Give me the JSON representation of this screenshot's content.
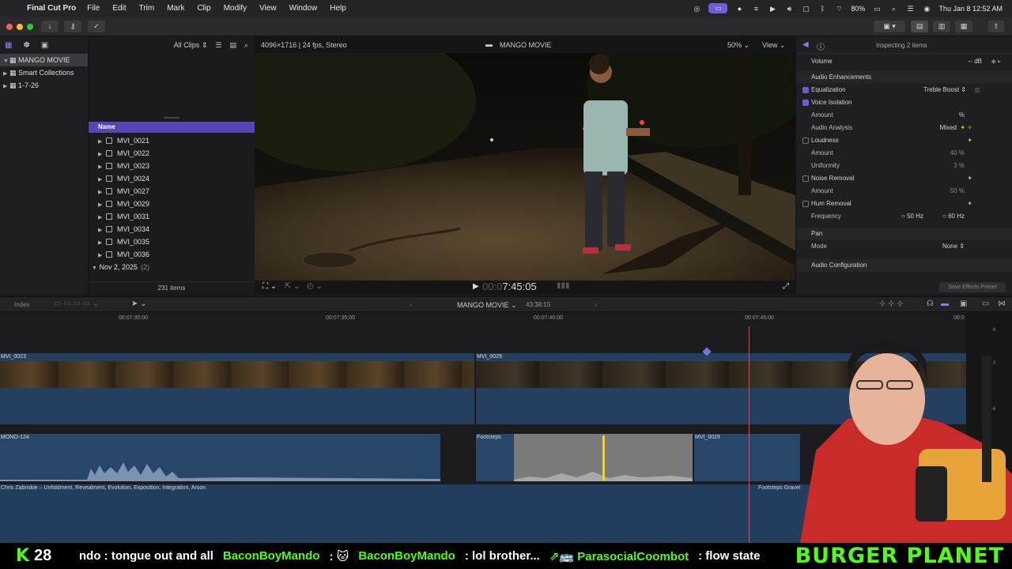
{
  "menubar": {
    "app_name": "Final Cut Pro",
    "items": [
      "File",
      "Edit",
      "Trim",
      "Mark",
      "Clip",
      "Modify",
      "View",
      "Window",
      "Help"
    ],
    "battery": "80%",
    "datetime": "Thu Jan 8  12:52 AM"
  },
  "library": {
    "root": "MANGO MOVIE",
    "items": [
      "Smart Collections",
      "1-7-26"
    ]
  },
  "browser": {
    "filter": "All Clips",
    "column_name": "Name",
    "clips": [
      "MVI_0021",
      "MVI_0022",
      "MVI_0023",
      "MVI_0024",
      "MVI_0027",
      "MVI_0029",
      "MVI_0031",
      "MVI_0034",
      "MVI_0035",
      "MVI_0036"
    ],
    "group_label": "Nov 2, 2025",
    "group_count": "(2)",
    "item_count": "231 items"
  },
  "viewer": {
    "format": "4096×1716 | 24 fps, Stereo",
    "project": "MANGO MOVIE",
    "zoom": "50%",
    "view_label": "View",
    "timecode_dim": "00:0",
    "timecode": "7:45:05"
  },
  "inspector": {
    "title": "Inspecting 2 items",
    "volume_label": "Volume",
    "volume_value": "-- dB",
    "enhancements_label": "Audio Enhancements",
    "equalization_label": "Equalization",
    "equalization_value": "Treble Boost",
    "voice_isolation_label": "Voice Isolation",
    "amount_label": "Amount",
    "amount_vi_value": "%",
    "audio_analysis_label": "Audio Analysis",
    "audio_analysis_value": "Mixed",
    "loudness_label": "Loudness",
    "loudness_amount_value": "40 %",
    "uniformity_label": "Uniformity",
    "uniformity_value": "3 %",
    "noise_removal_label": "Noise Removal",
    "noise_amount_value": "50 %",
    "hum_removal_label": "Hum Removal",
    "frequency_label": "Frequency",
    "freq_50": "50 Hz",
    "freq_60": "60 Hz",
    "pan_label": "Pan",
    "mode_label": "Mode",
    "mode_value": "None",
    "audio_config_label": "Audio Configuration",
    "save_preset": "Save Effects Preset"
  },
  "timeline": {
    "index_label": "Index",
    "project": "MANGO MOVIE",
    "duration": "43:38:15",
    "ruler_ticks": [
      "00:07:30:00",
      "00:07:35:00",
      "00:07:40:00",
      "00:07:45:00",
      "00:0"
    ],
    "meter_ticks": [
      "6",
      "0",
      "-6"
    ],
    "clips": {
      "v1": "MVI_0023",
      "v2": "MVI_0029",
      "a1": "MONO-124",
      "a2": "Footsteps",
      "a3": "MVI_0029",
      "music": "Chris Zabriskie – Unfoldment, Revealment, Evolution, Exposition, Integration, Arson",
      "music2": "Footsteps Gravel"
    }
  },
  "chat": {
    "viewer_count": "28",
    "messages": [
      {
        "user": "",
        "text": "ndo : tongue out and all"
      },
      {
        "user": "BaconBoyMando",
        "text": ": 🐱"
      },
      {
        "user": "BaconBoyMando",
        "text": ": lol brother..."
      },
      {
        "user": "⇗🚌 ParasocialCoombot",
        "text": ": flow state"
      }
    ],
    "brand": "BURGER PLANET"
  }
}
